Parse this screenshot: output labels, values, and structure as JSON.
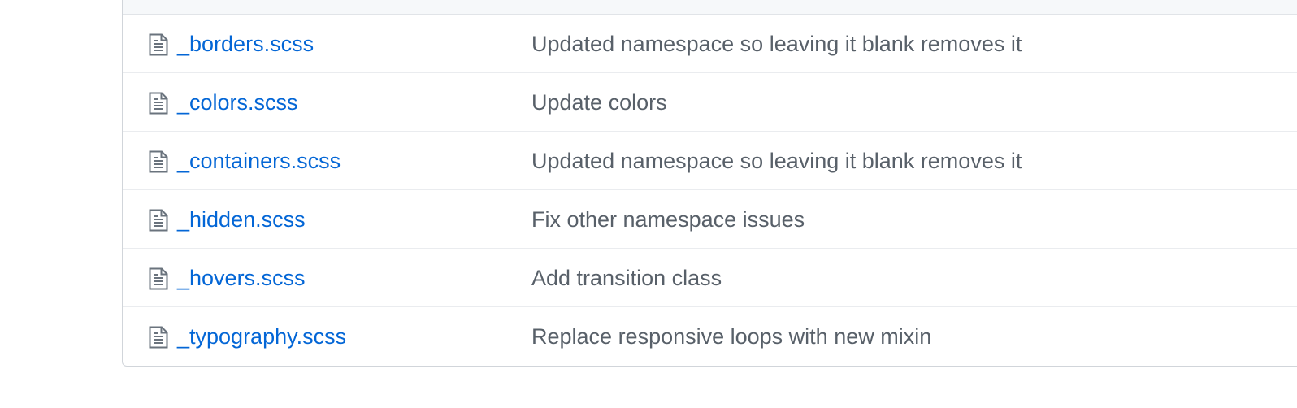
{
  "file_list": {
    "rows": [
      {
        "icon": "file-icon",
        "name": "_borders.scss",
        "message": "Updated namespace so leaving it blank removes it"
      },
      {
        "icon": "file-icon",
        "name": "_colors.scss",
        "message": "Update colors"
      },
      {
        "icon": "file-icon",
        "name": "_containers.scss",
        "message": "Updated namespace so leaving it blank removes it"
      },
      {
        "icon": "file-icon",
        "name": "_hidden.scss",
        "message": "Fix other namespace issues"
      },
      {
        "icon": "file-icon",
        "name": "_hovers.scss",
        "message": "Add transition class"
      },
      {
        "icon": "file-icon",
        "name": "_typography.scss",
        "message": "Replace responsive loops with new mixin"
      }
    ]
  },
  "colors": {
    "link": "#0366d6",
    "message": "#586069",
    "border": "#d1d5da",
    "header_bg": "#f6f8fa"
  }
}
